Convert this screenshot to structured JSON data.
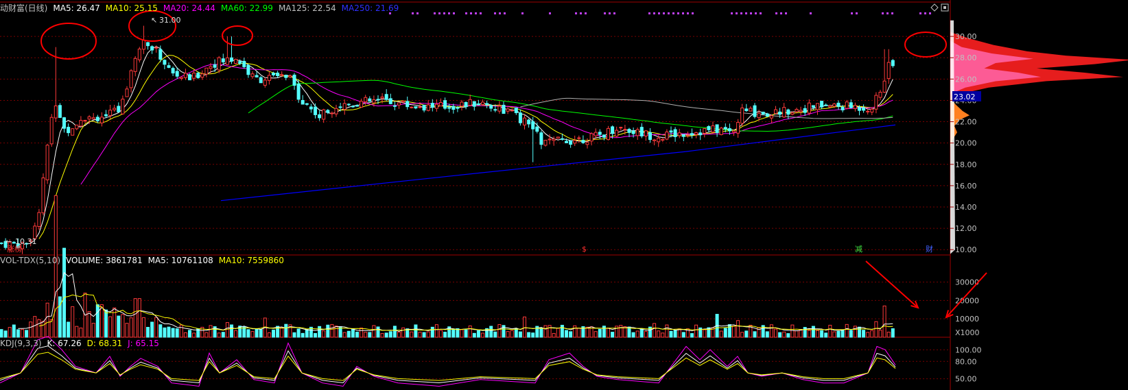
{
  "main_header": {
    "stock": "动财富(日线)",
    "ma5": "MA5: 26.47",
    "ma10": "MA10: 25.15",
    "ma20": "MA20: 24.44",
    "ma60": "MA60: 22.99",
    "ma125": "MA125: 22.54",
    "ma250": "MA250: 21.69"
  },
  "volume_header": {
    "indicator": "VOL-TDX(5,10)",
    "volume": "VOLUME: 3861781",
    "ma5": "MA5: 10761108",
    "ma10": "MA10: 7559860"
  },
  "kdj_header": {
    "indicator": "KDJ(9,3,3)",
    "k": "K: 67.26",
    "d": "D: 68.31",
    "j": "J: 65.15"
  },
  "price_axis": [
    "30.00",
    "28.00",
    "26.00",
    "24.00",
    "22.00",
    "20.00",
    "18.00",
    "16.00",
    "14.00",
    "12.00",
    "10.00"
  ],
  "volume_axis": [
    "30000",
    "20000",
    "10000"
  ],
  "volume_unit": "X1000",
  "kdj_axis": [
    "100.00",
    "80.00",
    "50.00"
  ],
  "current_price_tag": "23.02",
  "high_marker": "31.00",
  "low_marker": "10.31",
  "event_labels": [
    {
      "text": "涨榜",
      "color": "#ff3030"
    },
    {
      "text": "$",
      "color": "#ff3030"
    },
    {
      "text": "减",
      "color": "#40e040"
    },
    {
      "text": "财",
      "color": "#4060ff"
    }
  ],
  "colors": {
    "up": "#ff3a3a",
    "down": "#54ffff",
    "grid": "#7a0000",
    "ma5": "#ffffff",
    "ma10": "#ffff00",
    "ma20": "#ff00ff",
    "ma60": "#00ff00",
    "ma125": "#c0c0c0",
    "ma250": "#0000ff",
    "annotation": "#ff0000"
  },
  "toolbar_icons": [
    "diamond-icon",
    "square-icon"
  ]
}
